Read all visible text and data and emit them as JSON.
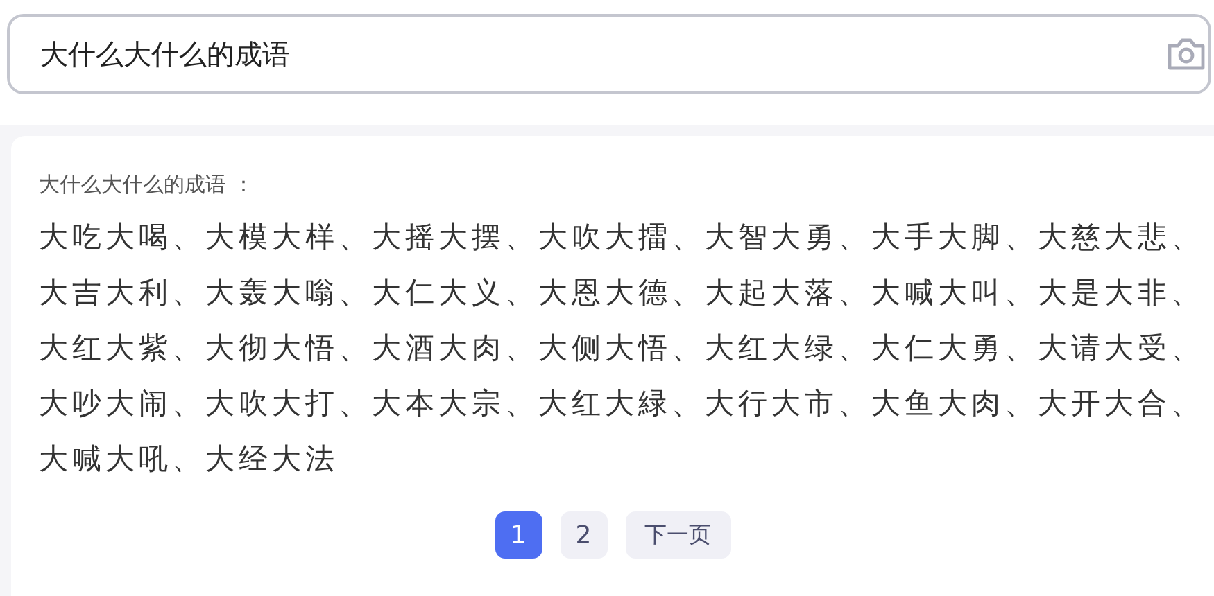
{
  "search": {
    "value": "大什么大什么的成语"
  },
  "result": {
    "heading": "大什么大什么的成语 ：",
    "text": "大吃大喝、大模大样、大摇大摆、大吹大擂、大智大勇、大手大脚、大慈大悲、大吉大利、大轰大嗡、大仁大义、大恩大德、大起大落、大喊大叫、大是大非、大红大紫、大彻大悟、大酒大肉、大侧大悟、大红大绿、大仁大勇、大请大受、大吵大闹、大吹大打、大本大宗、大红大緑、大行大市、大鱼大肉、大开大合、大喊大吼、大经大法"
  },
  "pagination": {
    "pages": [
      {
        "label": "1",
        "selected": true
      },
      {
        "label": "2",
        "selected": false
      }
    ],
    "next": "下一页"
  }
}
